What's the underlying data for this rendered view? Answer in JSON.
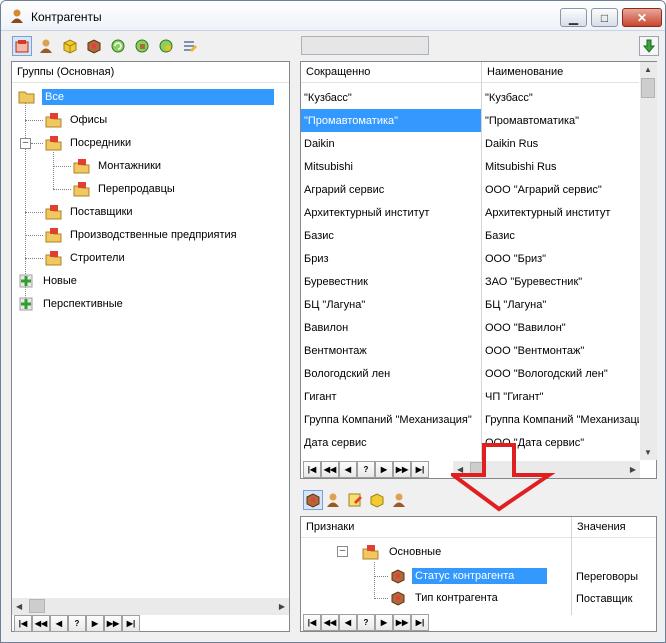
{
  "window": {
    "title": "Контрагенты"
  },
  "toolbar": {
    "buttons": [
      {
        "name": "new-card-icon",
        "color": "#d23a2a"
      },
      {
        "name": "person-icon",
        "color": "#d68a2e"
      },
      {
        "name": "box-icon",
        "color": "#e8c020"
      },
      {
        "name": "package-icon",
        "color": "#a05a2a"
      },
      {
        "name": "refresh-icon",
        "color": "#3aa040"
      },
      {
        "name": "refresh-box-icon",
        "color": "#3aa040"
      },
      {
        "name": "refresh-money-icon",
        "color": "#3aa040"
      },
      {
        "name": "edit-list-icon",
        "color": "#7080a0"
      }
    ],
    "search_value": "",
    "download_icon": "download-arrow-icon"
  },
  "groups": {
    "header": "Группы (Основная)",
    "nodes": [
      {
        "label": "Все",
        "level": 0,
        "icon": "folder-open-icon",
        "selected": true
      },
      {
        "label": "Офисы",
        "level": 1,
        "icon": "folder-card-icon"
      },
      {
        "label": "Посредники",
        "level": 1,
        "icon": "folder-card-icon",
        "expanded": true
      },
      {
        "label": "Монтажники",
        "level": 2,
        "icon": "folder-card-icon"
      },
      {
        "label": "Перепродавцы",
        "level": 2,
        "icon": "folder-card-icon"
      },
      {
        "label": "Поставщики",
        "level": 1,
        "icon": "folder-card-icon"
      },
      {
        "label": "Производственные предприятия",
        "level": 1,
        "icon": "folder-card-icon"
      },
      {
        "label": "Строители",
        "level": 1,
        "icon": "folder-card-icon"
      },
      {
        "label": "Новые",
        "level": 0,
        "icon": "plus-green-icon"
      },
      {
        "label": "Перспективные",
        "level": 0,
        "icon": "plus-green-icon"
      }
    ]
  },
  "contractors": {
    "columns": [
      "Сокращенно",
      "Наименование"
    ],
    "rows": [
      [
        "\"Кузбасс\"",
        "\"Кузбасс\""
      ],
      [
        "\"Промавтоматика\"",
        "\"Промавтоматика\""
      ],
      [
        "Daikin",
        "Daikin Rus"
      ],
      [
        "Mitsubishi",
        "Mitsubishi Rus"
      ],
      [
        "Аграрий сервис",
        "ООО \"Аграрий сервис\""
      ],
      [
        "Архитектурный институт",
        "Архитектурный институт"
      ],
      [
        "Базис",
        "Базис"
      ],
      [
        "Бриз",
        "ООО \"Бриз\""
      ],
      [
        "Буревестник",
        "ЗАО \"Буревестник\""
      ],
      [
        "БЦ \"Лагуна\"",
        "БЦ \"Лагуна\""
      ],
      [
        "Вавилон",
        "ООО \"Вавилон\""
      ],
      [
        "Вентмонтаж",
        "ООО \"Вентмонтаж\""
      ],
      [
        "Вологодский лен",
        "ООО \"Вологодский лен\""
      ],
      [
        "Гигант",
        "ЧП \"Гигант\""
      ],
      [
        "Группа Компаний \"Механизация\"",
        "Группа Компаний \"Механизация\""
      ],
      [
        "Дата сервис",
        "ООО \"Дата сервис\""
      ]
    ],
    "selected_row": 1
  },
  "nav": [
    "|◀",
    "◀◀",
    "◀",
    "?",
    "▶",
    "▶▶",
    "▶|"
  ],
  "attributes_toolbar": [
    "package-icon",
    "person-icon",
    "note-icon",
    "box-icon",
    "person-icon"
  ],
  "attributes": {
    "columns": [
      "Признаки",
      "Значения"
    ],
    "group": "Основные",
    "items": [
      {
        "label": "Статус контрагента",
        "value": "Переговоры",
        "selected": true
      },
      {
        "label": "Тип контрагента",
        "value": "Поставщик"
      }
    ]
  },
  "annotation": {
    "arrow_color": "#e02020"
  }
}
